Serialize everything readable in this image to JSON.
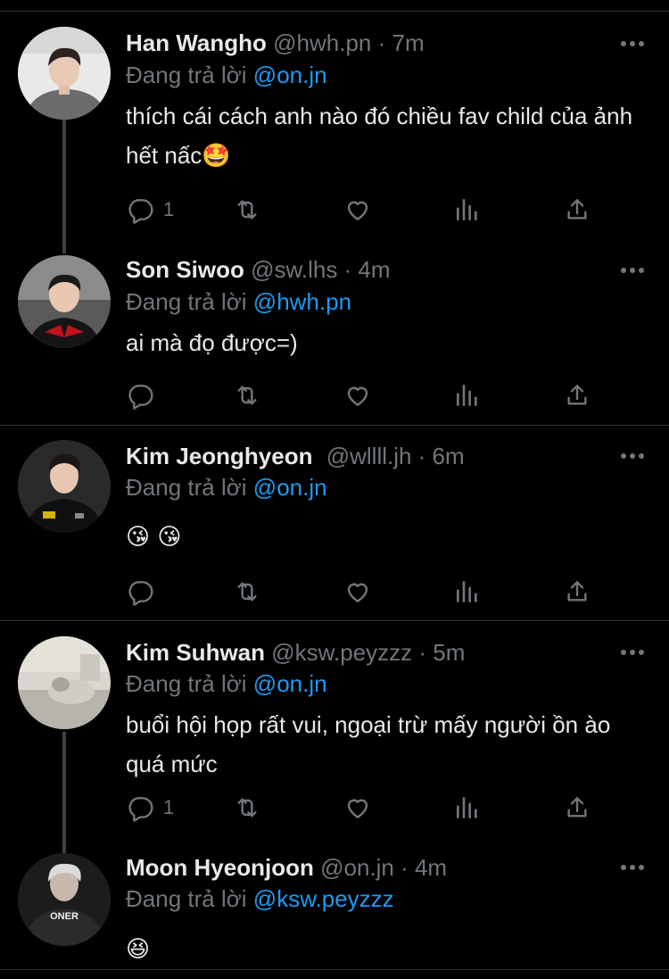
{
  "theme": {
    "background": "#000000",
    "text": "#e7e9ea",
    "muted": "#71767b",
    "link": "#1d9bf0",
    "divider": "#2f3336"
  },
  "tweets": [
    {
      "name": "Han Wangho",
      "handle_time": "@hwh.pn · 7m",
      "replying_prefix": "Đang trả lời",
      "replying_to": "@on.jn",
      "text": "thích cái cách anh nào đó chiều fav child của ảnh hết nấc🤩",
      "reply_count": "1",
      "icons": [
        "reply-icon",
        "retweet-icon",
        "like-icon",
        "analytics-icon",
        "share-icon",
        "more-icon"
      ]
    },
    {
      "name": "Son Siwoo",
      "handle_time": "@sw.lhs · 4m",
      "replying_prefix": "Đang trả lời",
      "replying_to": "@hwh.pn",
      "text": "ai mà đọ được=)",
      "reply_count": ""
    },
    {
      "name": "Kim Jeonghyeon",
      "handle_time": "@wllll.jh · 6m",
      "replying_prefix": "Đang trả lời",
      "replying_to": "@on.jn",
      "text": "😘 😘",
      "reply_count": ""
    },
    {
      "name": "Kim Suhwan",
      "handle_time": "@ksw.peyzzz · 5m",
      "replying_prefix": "Đang trả lời",
      "replying_to": "@on.jn",
      "text": "buổi hội họp rất vui, ngoại trừ mấy người ồn ào quá mức",
      "reply_count": "1"
    },
    {
      "name": "Moon Hyeonjoon",
      "handle_time": "@on.jn · 4m",
      "replying_prefix": "Đang trả lời",
      "replying_to": "@ksw.peyzzz",
      "text": "😆",
      "avatar_jersey_text": "ONER"
    }
  ]
}
